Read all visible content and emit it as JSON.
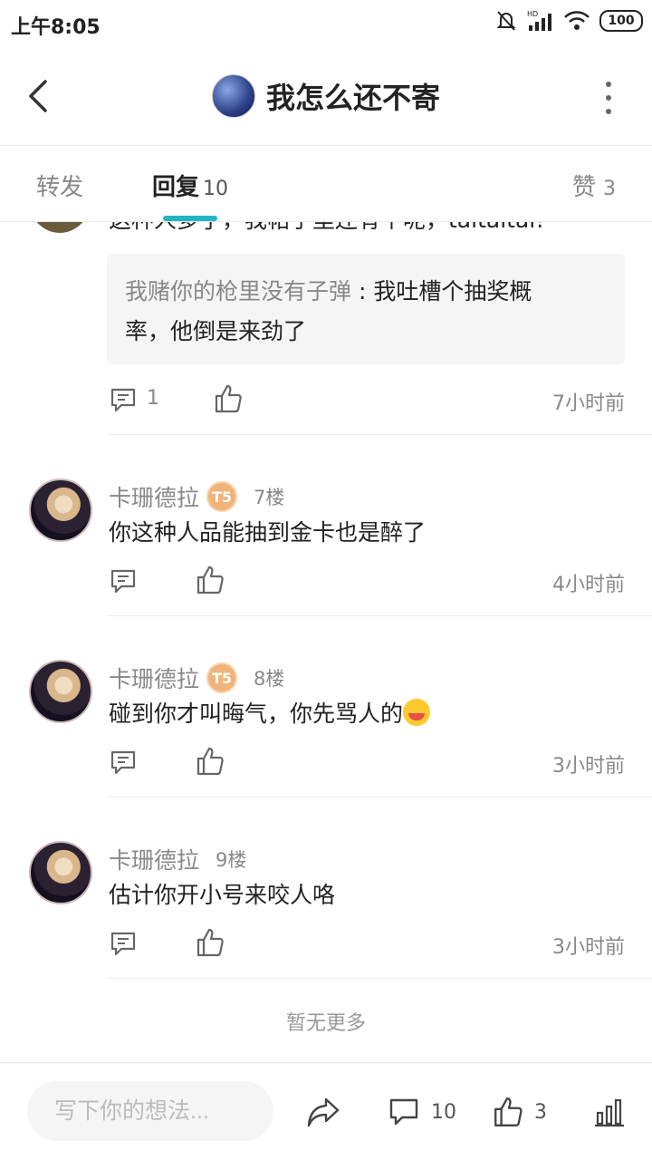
{
  "status_bar": {
    "time": "上午8:05",
    "battery": "100"
  },
  "header": {
    "title": "我怎么还不寄"
  },
  "tabs": {
    "forward": "转发",
    "reply": "回复",
    "reply_count": "10",
    "like": "赞",
    "like_count": "3"
  },
  "partial_comment": {
    "text": "这种人多了，我帖子里还有个呢，taitaitai!",
    "quote_author": "我赌你的枪里没有子弹",
    "quote_sep": " : ",
    "quote_text_1": "我吐槽个抽奖概",
    "quote_text_2": "率，他倒是来劲了",
    "comment_count": "1",
    "time": "7小时前"
  },
  "replies": [
    {
      "username": "卡珊德拉",
      "badge": "T5",
      "floor": "7楼",
      "text": "你这种人品能抽到金卡也是醉了",
      "time": "4小时前"
    },
    {
      "username": "卡珊德拉",
      "badge": "T5",
      "floor": "8楼",
      "text": "碰到你才叫晦气，你先骂人的",
      "time": "3小时前"
    },
    {
      "username": "卡珊德拉",
      "floor": "9楼",
      "text": "估计你开小号来咬人咯",
      "time": "3小时前"
    }
  ],
  "no_more": "暂无更多",
  "bottom_bar": {
    "input_placeholder": "写下你的想法...",
    "comment_count": "10",
    "like_count": "3"
  }
}
